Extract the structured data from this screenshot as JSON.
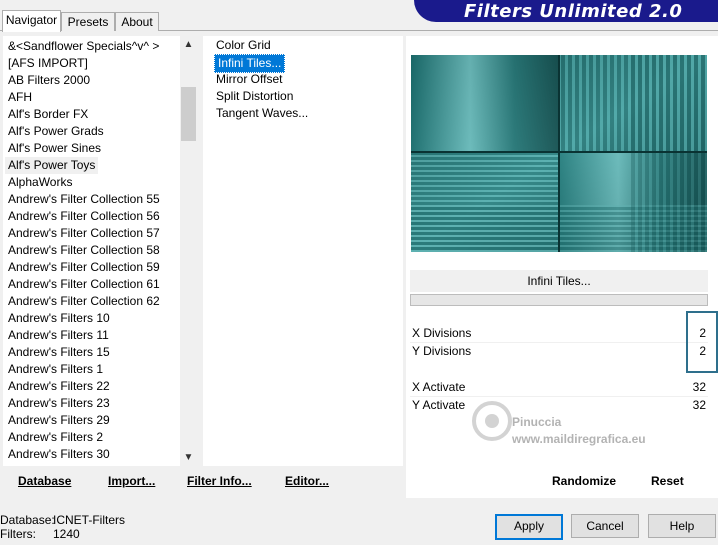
{
  "window_title": "Filters Unlimited 2.0",
  "tabs": [
    "Navigator",
    "Presets",
    "About"
  ],
  "categories": [
    "&<Sandflower Specials^v^ >",
    "[AFS IMPORT]",
    "AB Filters 2000",
    "AFH",
    "Alf's Border FX",
    "Alf's Power Grads",
    "Alf's Power Sines",
    "Alf's Power Toys",
    "AlphaWorks",
    "Andrew's Filter Collection 55",
    "Andrew's Filter Collection 56",
    "Andrew's Filter Collection 57",
    "Andrew's Filter Collection 58",
    "Andrew's Filter Collection 59",
    "Andrew's Filter Collection 61",
    "Andrew's Filter Collection 62",
    "Andrew's Filters 10",
    "Andrew's Filters 11",
    "Andrew's Filters 15",
    "Andrew's Filters 1",
    "Andrew's Filters 22",
    "Andrew's Filters 23",
    "Andrew's Filters 29",
    "Andrew's Filters 2",
    "Andrew's Filters 30"
  ],
  "selected_category": "Alf's Power Toys",
  "filters": [
    "Color Grid",
    "Infini Tiles...",
    "Mirror Offset",
    "Split Distortion",
    "Tangent Waves..."
  ],
  "selected_filter": "Infini Tiles...",
  "filter_name": "Infini Tiles...",
  "params": [
    {
      "label": "X Divisions",
      "value": "2"
    },
    {
      "label": "Y Divisions",
      "value": "2"
    },
    {
      "label": "X Activate",
      "value": "32"
    },
    {
      "label": "Y Activate",
      "value": "32"
    }
  ],
  "bottom_buttons": {
    "database": "Database",
    "import": "Import...",
    "filter_info": "Filter Info...",
    "editor": "Editor...",
    "randomize": "Randomize",
    "reset": "Reset"
  },
  "info": {
    "database_label": "Database:",
    "database_value": "ICNET-Filters",
    "filters_label": "Filters:",
    "filters_value": "1240"
  },
  "dialog_buttons": {
    "apply": "Apply",
    "cancel": "Cancel",
    "help": "Help"
  },
  "watermark": {
    "line1": "Pinuccia",
    "line2": "www.maildiregrafica.eu"
  },
  "colors": {
    "accent": "#0078d7",
    "banner": "#1a1a8c",
    "preview_teal": "#2a8a8a"
  },
  "icons": {
    "scroll_up": "▲",
    "scroll_down": "▼"
  }
}
